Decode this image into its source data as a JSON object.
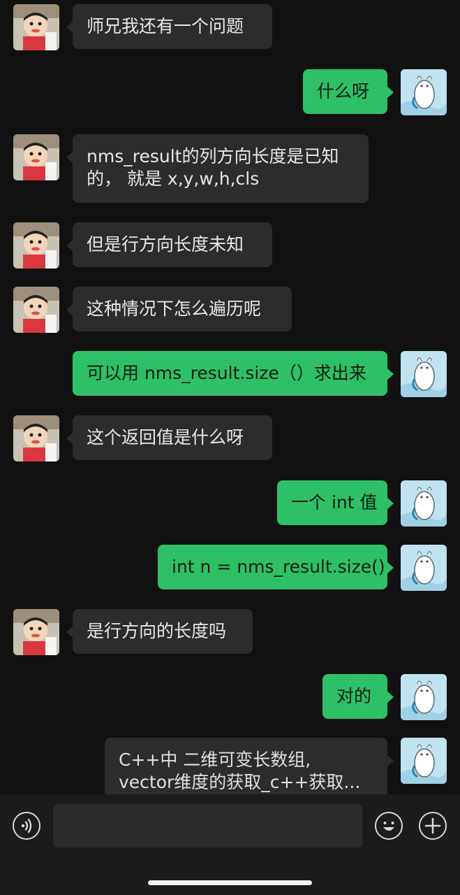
{
  "conversation": {
    "messages": [
      {
        "side": "in",
        "text": "师兄我还有一个问题"
      },
      {
        "side": "out",
        "text": "什么呀"
      },
      {
        "side": "in",
        "lines": [
          "nms_result的列方向长度是已知",
          "的，  就是 x,y,w,h,cls"
        ]
      },
      {
        "side": "in",
        "text": "但是行方向长度未知"
      },
      {
        "side": "in",
        "text": "这种情况下怎么遍历呢"
      },
      {
        "side": "out",
        "text": "可以用 nms_result.size（）求出来"
      },
      {
        "side": "in",
        "text": "这个返回值是什么呀"
      },
      {
        "side": "out",
        "text": "一个 int 值"
      },
      {
        "side": "out",
        "text": "int n = nms_result.size()"
      },
      {
        "side": "in",
        "text": "是行方向的长度吗"
      },
      {
        "side": "out",
        "text": "对的"
      },
      {
        "side": "out-link",
        "lines": [
          "C++中 二维可变长数组,",
          "vector维度的获取_c++获取..."
        ]
      }
    ]
  },
  "input_bar": {
    "voice_icon": "voice-icon",
    "emoji_icon": "emoji-icon",
    "plus_icon": "plus-icon",
    "placeholder": ""
  },
  "colors": {
    "background": "#111111",
    "incoming_bubble": "#2c2c2c",
    "outgoing_bubble": "#2ec067",
    "bottom_bar": "#1c1c1c"
  }
}
